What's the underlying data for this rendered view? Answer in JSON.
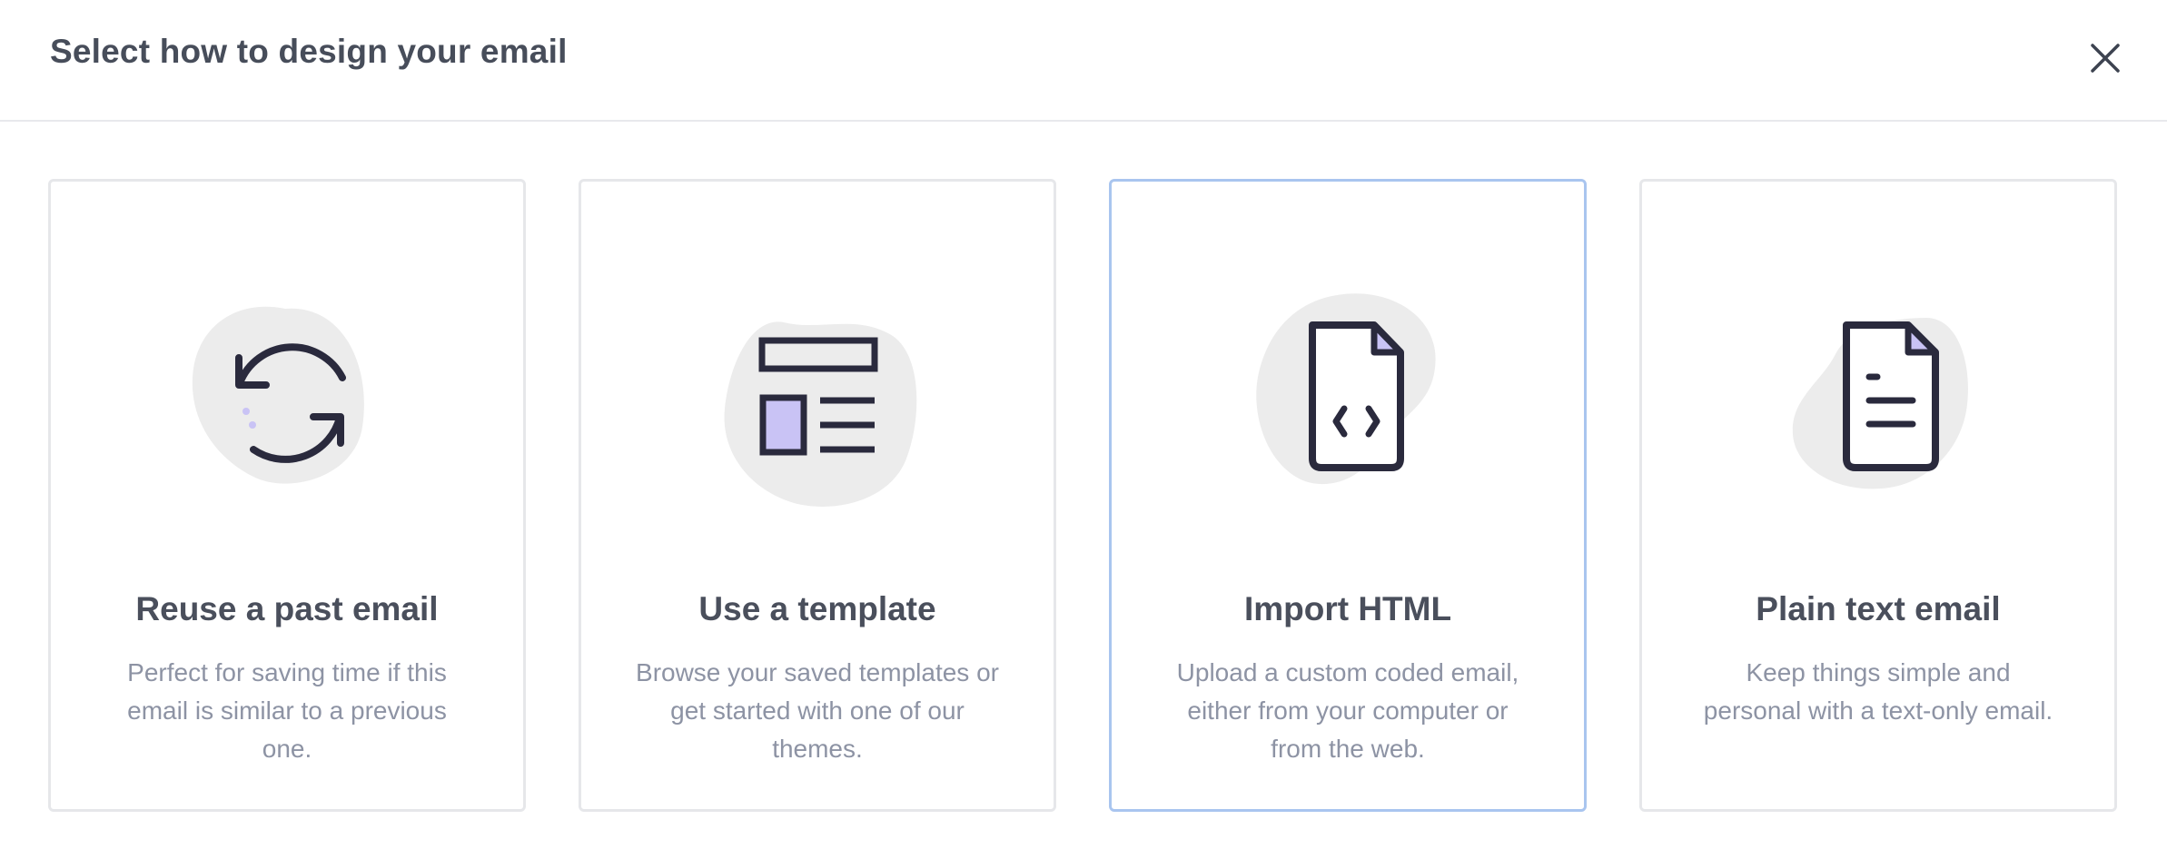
{
  "modal": {
    "title": "Select how to design your email",
    "close_icon": "close-icon"
  },
  "options": [
    {
      "title": "Reuse a past email",
      "description": "Perfect for saving time if this email is similar to a previous one.",
      "icon": "refresh-icon",
      "selected": false
    },
    {
      "title": "Use a template",
      "description": "Browse your saved templates or get started with one of our themes.",
      "icon": "template-layout-icon",
      "selected": false
    },
    {
      "title": "Import HTML",
      "description": "Upload a custom coded email, either from your computer or from the web.",
      "icon": "code-file-icon",
      "selected": true
    },
    {
      "title": "Plain text email",
      "description": "Keep things simple and personal with a text-only email.",
      "icon": "text-file-icon",
      "selected": false
    }
  ],
  "colors": {
    "icon_stroke": "#2a2a3d",
    "icon_accent": "#c9c3f5",
    "blob": "#ececec",
    "selected_border": "#a9c5ef",
    "card_border": "#e6e7ea"
  }
}
